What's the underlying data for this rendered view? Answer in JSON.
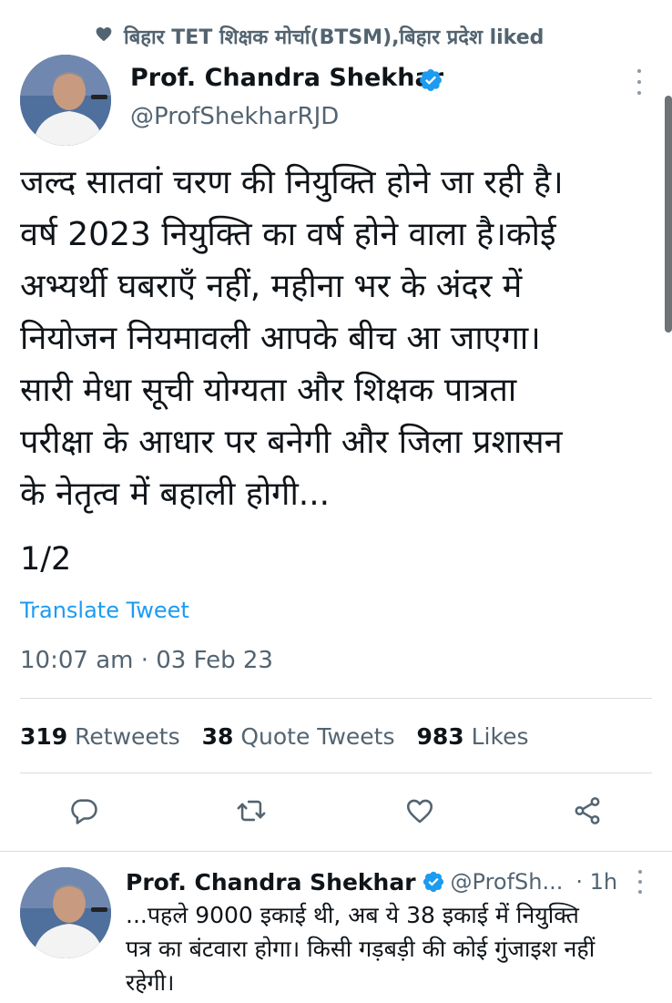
{
  "social_context": {
    "icon": "heart-icon",
    "text": "बिहार TET शिक्षक मोर्चा(BTSM),बिहार प्रदेश liked"
  },
  "tweet": {
    "author_name": "Prof. Chandra Shekhar",
    "author_handle": "@ProfShekharRJD",
    "verified_color": "#1d9bf0",
    "text_lines": [
      "जल्द सातवां चरण की नियुक्ति होने जा रही है।",
      "वर्ष 2023 नियुक्ति का वर्ष होने वाला है।कोई",
      "अभ्यर्थी घबराएँ नहीं, महीना भर के अंदर में",
      "नियोजन नियमावली आपके बीच आ जाएगा।",
      "सारी मेधा सूची योग्यता और शिक्षक पात्रता",
      "परीक्षा के आधार पर बनेगी और जिला प्रशासन",
      "के नेतृत्व में बहाली होगी..."
    ],
    "thread_count": "1/2",
    "translate_label": "Translate Tweet",
    "timestamp": "10:07 am · 03 Feb 23",
    "stats": {
      "retweets_count": "319",
      "retweets_label": "Retweets",
      "quotes_count": "38",
      "quotes_label": "Quote Tweets",
      "likes_count": "983",
      "likes_label": "Likes"
    },
    "actions": [
      "reply-icon",
      "retweet-icon",
      "like-icon",
      "share-icon"
    ]
  },
  "reply": {
    "author_name": "Prof. Chandra Shekhar",
    "author_handle": "@ProfSh...",
    "time": "· 1h",
    "text_lines": [
      "...पहले 9000 इकाई थी, अब ये 38 इकाई में नियुक्ति",
      "पत्र का बंटवारा होगा। किसी गड़बड़ी की कोई गुंजाइश नहीं",
      "रहेगी।"
    ]
  },
  "colors": {
    "accent": "#1d9bf0",
    "secondary_text": "#536471",
    "icon_gray": "#536471"
  }
}
